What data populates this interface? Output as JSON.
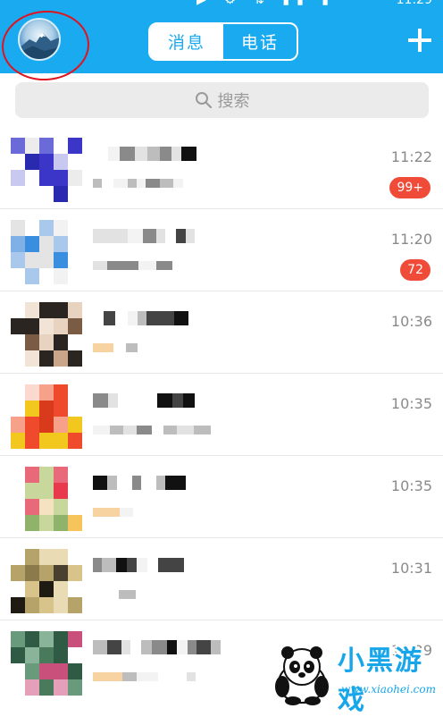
{
  "header": {
    "tabs": [
      {
        "label": "消息",
        "active": true
      },
      {
        "label": "电话",
        "active": false
      }
    ],
    "add_icon": "plus-icon",
    "avatar_icon": "profile-avatar",
    "accent_color": "#19aaf0",
    "highlight_color": "#e0141e"
  },
  "search": {
    "placeholder": "搜索",
    "icon": "search-icon"
  },
  "conversations": [
    {
      "time": "11:22",
      "badge": "99+"
    },
    {
      "time": "11:20",
      "badge": "72"
    },
    {
      "time": "10:36",
      "badge": ""
    },
    {
      "time": "10:35",
      "badge": ""
    },
    {
      "time": "10:35",
      "badge": ""
    },
    {
      "time": "10:31",
      "badge": ""
    },
    {
      "time": "10:29",
      "badge": ""
    }
  ],
  "badge_color": "#f04b38",
  "watermark": {
    "title": "小黑游戏",
    "url": "www.xiaohei.com"
  }
}
